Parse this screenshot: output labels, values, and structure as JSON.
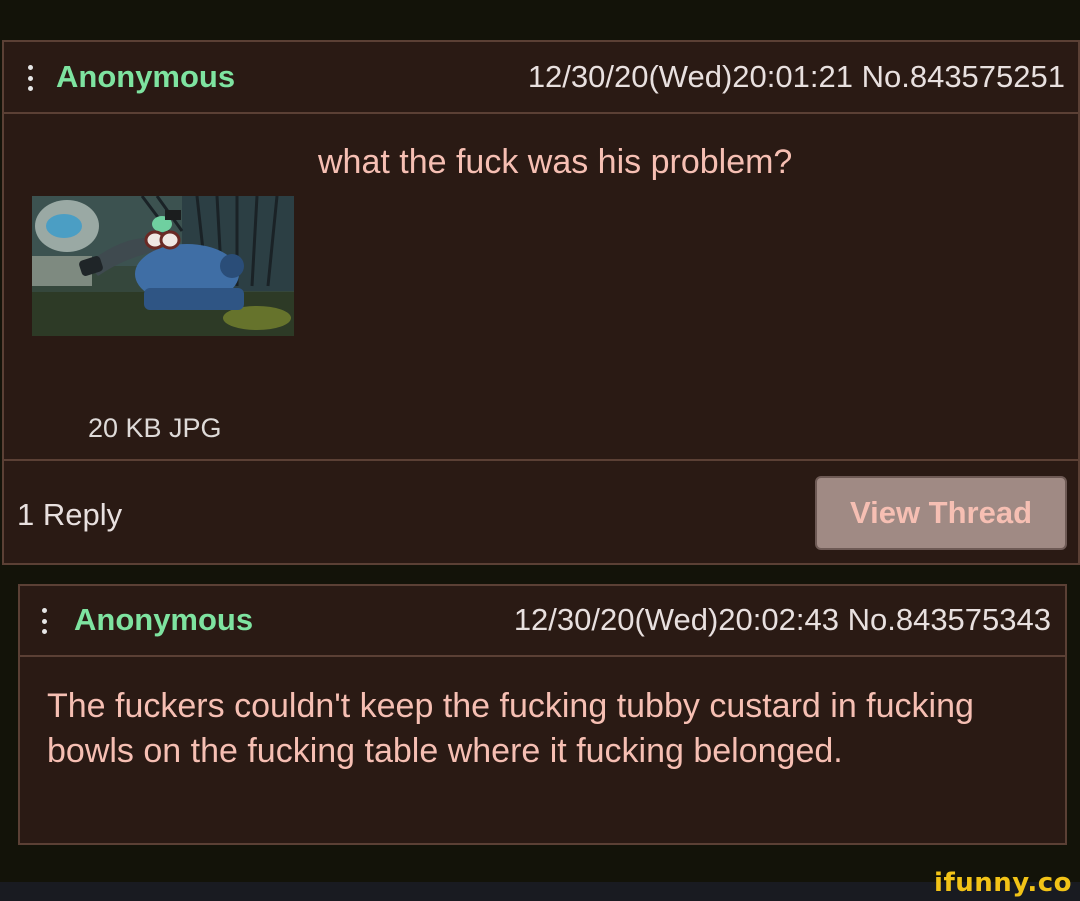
{
  "op": {
    "name": "Anonymous",
    "meta": "12/30/20(Wed)20:01:21 No.843575251",
    "text": "what the fuck was his problem?",
    "file_info": "20 KB JPG",
    "reply_count": "1 Reply",
    "view_thread_label": "View Thread"
  },
  "reply": {
    "name": "Anonymous",
    "meta": "12/30/20(Wed)20:02:43 No.843575343",
    "text": "The fuckers couldn't keep the fucking tubby custard in fucking bowls on the fucking table where it fucking belonged."
  },
  "watermark": "ifunny.co",
  "colors": {
    "background": "#131309",
    "post_bg": "#2a1a14",
    "border": "#5b4035",
    "name": "#7ee3a0",
    "post_text": "#f6bfb3",
    "meta_text": "#e8e0df",
    "button_bg": "#a08a84",
    "watermark": "#f2c317"
  },
  "icons": [
    "kebab-menu-icon"
  ]
}
